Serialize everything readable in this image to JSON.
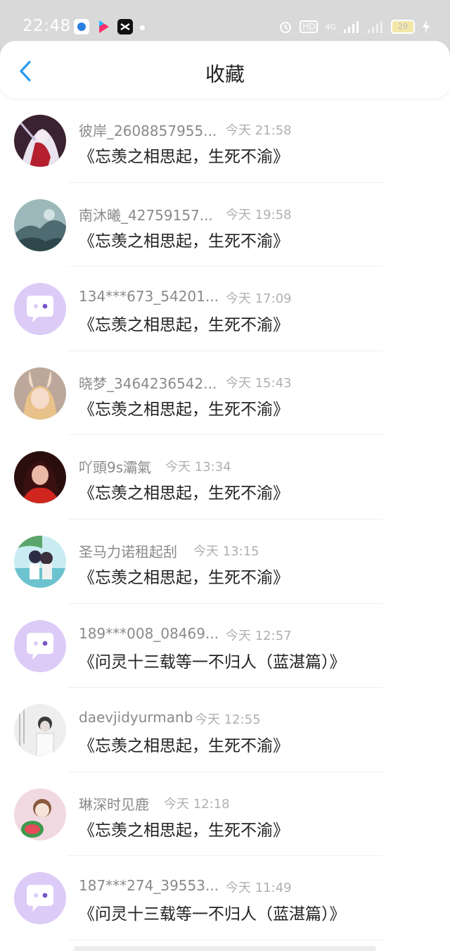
{
  "status_bar": {
    "time": "22:48",
    "app_icons": [
      "app-icon-blue-circle",
      "youku-icon",
      "capcut-icon"
    ],
    "network": "4G",
    "hd_label": "HD",
    "battery": "29"
  },
  "header": {
    "title": "收藏",
    "back_icon": "chevron-left-icon"
  },
  "colors": {
    "accent": "#2a9bf0",
    "title_text": "#222222",
    "meta_text": "#8a8a8a",
    "default_avatar": "#d9c6f5"
  },
  "items": [
    {
      "name": "彼岸_2608857955...",
      "time": "今天 21:58",
      "title": "《忘羡之相思起，生死不渝》",
      "avatar": "avatar-anime-white-hair"
    },
    {
      "name": "南沐曦_42759157...",
      "time": "今天 19:58",
      "title": "《忘羡之相思起，生死不渝》",
      "avatar": "avatar-ink-landscape"
    },
    {
      "name": "134***673_54201...",
      "time": "今天 17:09",
      "title": "《忘羡之相思起，生死不渝》",
      "avatar": "default-chat-avatar"
    },
    {
      "name": "晓梦_3464236542...",
      "time": "今天 15:43",
      "title": "《忘羡之相思起，生死不渝》",
      "avatar": "avatar-doll-bunny-ears"
    },
    {
      "name": "吖頭9s灞氣",
      "time": "今天 13:34",
      "title": "《忘羡之相思起，生死不渝》",
      "avatar": "avatar-girl-red"
    },
    {
      "name": "圣马力诺租起刮",
      "time": "今天 13:15",
      "title": "《忘羡之相思起，生死不渝》",
      "avatar": "avatar-anime-couple-beach"
    },
    {
      "name": "189***008_08469...",
      "time": "今天 12:57",
      "title": "《问灵十三载等一不归人（蓝湛篇）》",
      "avatar": "default-chat-avatar"
    },
    {
      "name": "daevjidyurmanb",
      "time": "今天 12:55",
      "title": "《忘羡之相思起，生死不渝》",
      "avatar": "avatar-sketch-boy"
    },
    {
      "name": "琳深时见鹿",
      "time": "今天 12:18",
      "title": "《忘羡之相思起，生死不渝》",
      "avatar": "avatar-cartoon-watermelon"
    },
    {
      "name": "187***274_39553...",
      "time": "今天 11:49",
      "title": "《问灵十三载等一不归人（蓝湛篇）》",
      "avatar": "default-chat-avatar"
    }
  ]
}
